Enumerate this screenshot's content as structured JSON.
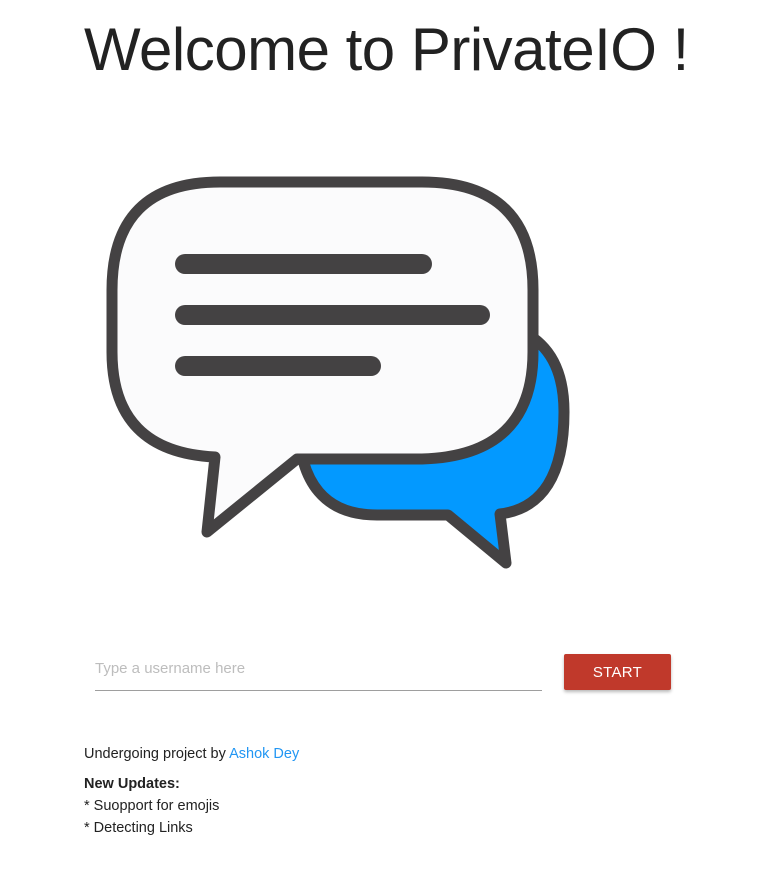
{
  "header": {
    "title": "Welcome to PrivateIO !"
  },
  "hero": {
    "icon": "chat-bubbles-icon",
    "colors": {
      "outline": "#444243",
      "front_bubble": "#fbfbfc",
      "back_bubble": "#0399ff"
    }
  },
  "login": {
    "username_placeholder": "Type a username here",
    "username_value": "",
    "start_label": "START",
    "start_color": "#c0392b"
  },
  "footer": {
    "credit_prefix": "Undergoing project by ",
    "author_name": "Ashok Dey",
    "updates_title": "New Updates:",
    "updates": [
      "* Suopport for emojis",
      "* Detecting Links"
    ]
  }
}
